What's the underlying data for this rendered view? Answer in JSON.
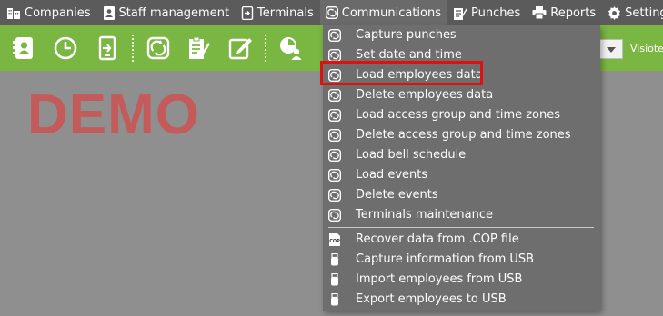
{
  "menubar": {
    "items": [
      {
        "label": "Companies",
        "icon": "building-icon"
      },
      {
        "label": "Staff management",
        "icon": "contact-card-icon"
      },
      {
        "label": "Terminals",
        "icon": "terminal-icon"
      },
      {
        "label": "Communications",
        "icon": "sync-icon"
      },
      {
        "label": "Punches",
        "icon": "punches-icon"
      },
      {
        "label": "Reports",
        "icon": "printer-icon"
      },
      {
        "label": "Setting",
        "icon": "gear-icon"
      }
    ]
  },
  "toolbar": {
    "visitors_label": "Visiote"
  },
  "watermark": "DEMO",
  "communications_menu": {
    "items": [
      {
        "label": "Capture punches",
        "icon": "sync-icon"
      },
      {
        "label": "Set date and time",
        "icon": "sync-icon"
      },
      {
        "label": "Load employees data",
        "icon": "sync-icon",
        "highlighted": true
      },
      {
        "label": "Delete employees data",
        "icon": "sync-icon"
      },
      {
        "label": "Load access group and time zones",
        "icon": "sync-icon"
      },
      {
        "label": "Delete access group and time zones",
        "icon": "sync-icon"
      },
      {
        "label": "Load bell schedule",
        "icon": "sync-icon"
      },
      {
        "label": "Load events",
        "icon": "sync-icon"
      },
      {
        "label": "Delete events",
        "icon": "sync-icon"
      },
      {
        "label": "Terminals maintenance",
        "icon": "sync-icon"
      },
      {
        "label": "Recover data from .COP file",
        "icon": "cop-file-icon",
        "icon_text": "COP"
      },
      {
        "label": "Capture information from USB",
        "icon": "usb-icon"
      },
      {
        "label": "Import employees from USB",
        "icon": "usb-icon"
      },
      {
        "label": "Export employees to USB",
        "icon": "usb-icon"
      }
    ]
  },
  "colors": {
    "menubar_bg": "#5b5b5b",
    "toolbar_bg": "#7ab642",
    "dropdown_bg": "#6e6e6e",
    "highlight_border": "#e01010",
    "watermark": "#c45b5b"
  }
}
